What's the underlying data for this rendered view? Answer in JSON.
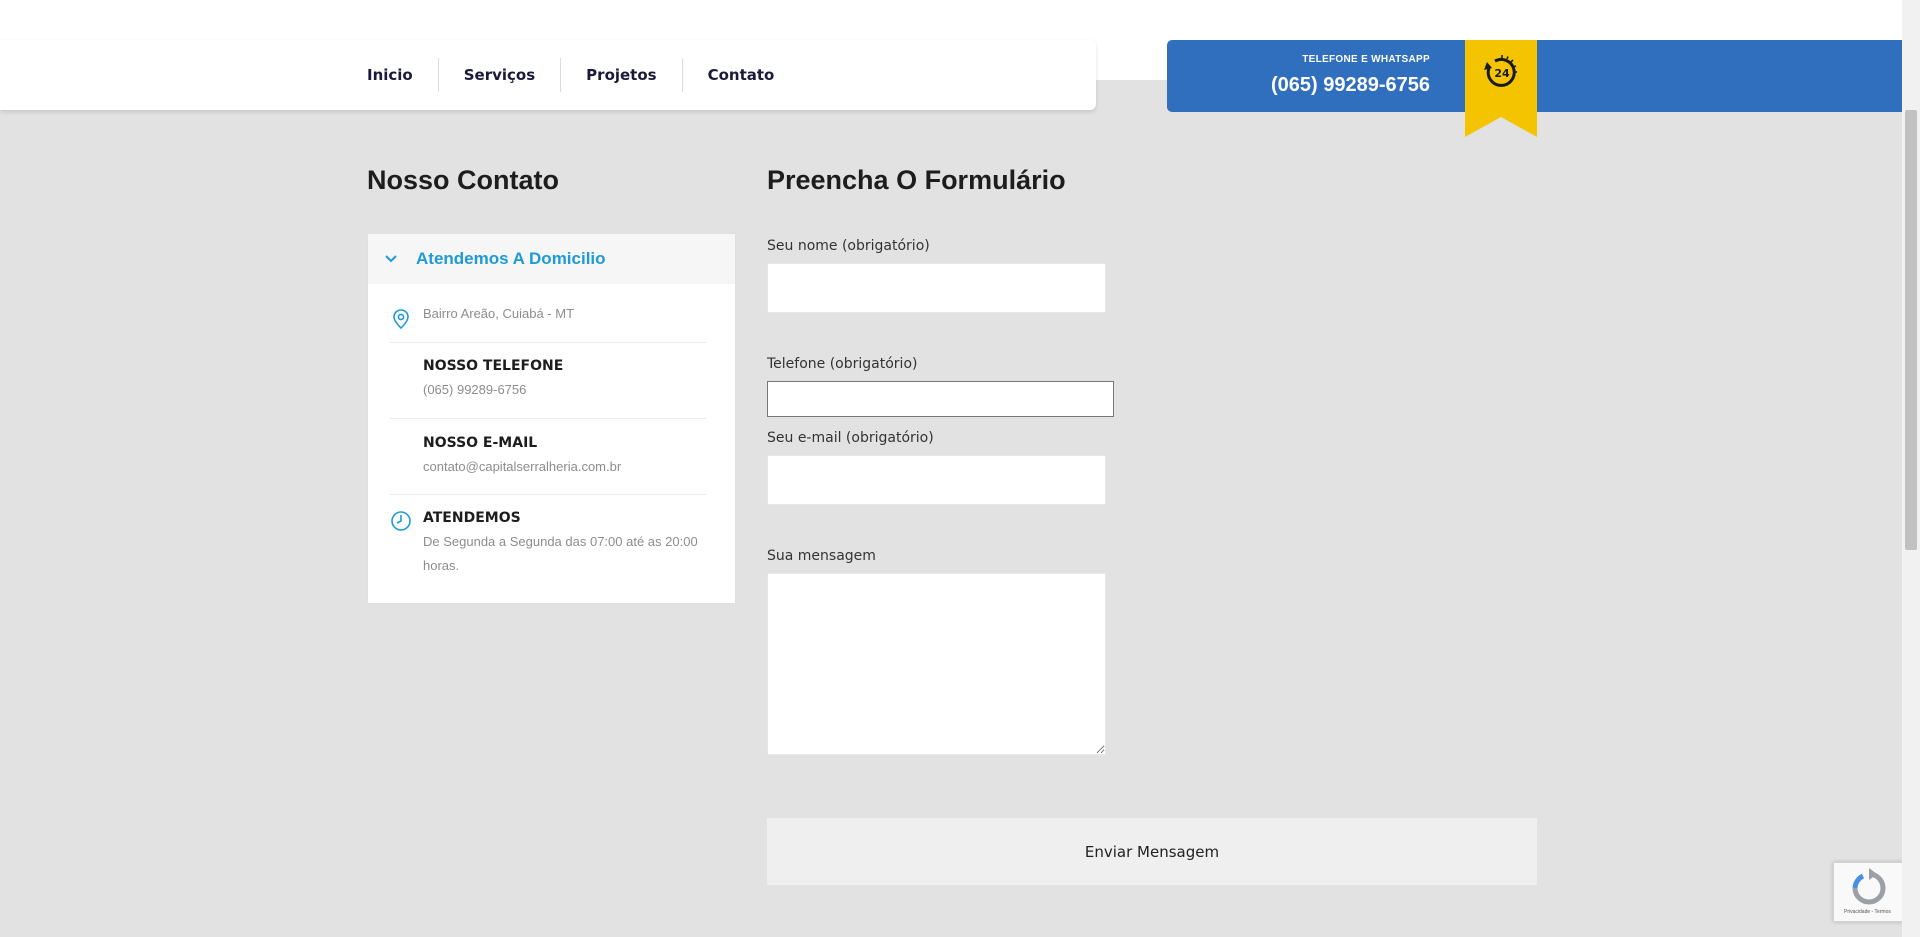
{
  "nav": {
    "items": [
      {
        "label": "Inicio"
      },
      {
        "label": "Serviços"
      },
      {
        "label": "Projetos"
      },
      {
        "label": "Contato"
      }
    ]
  },
  "phone_box": {
    "label": "TELEFONE E WHATSAPP",
    "number": "(065) 99289-6756",
    "badge_text": "24",
    "color": "#2f6fbd",
    "badge_color": "#f5c400"
  },
  "contact": {
    "heading": "Nosso Contato",
    "card_title": "Atendemos A Domicilio",
    "accent_color": "#1e9bd7",
    "address": "Bairro Areão, Cuiabá - MT",
    "phone_title": "NOSSO TELEFONE",
    "phone": "(065) 99289-6756",
    "email_title": "NOSSO E-MAIL",
    "email": "contato@capitalserralheria.com.br",
    "hours_title": "ATENDEMOS",
    "hours": "De Segunda a Segunda das 07:00 até as 20:00 horas.",
    "icons": {
      "address": "map-pin-icon",
      "hours": "clock-icon",
      "card": "chevron-down-icon"
    }
  },
  "form": {
    "heading": "Preencha O Formulário",
    "name_label": "Seu nome (obrigatório)",
    "phone_label": "Telefone (obrigatório)",
    "email_label": "Seu e-mail (obrigatório)",
    "message_label": "Sua mensagem",
    "name_value": "",
    "phone_value": "",
    "email_value": "",
    "message_value": "",
    "submit_label": "Enviar Mensagem"
  },
  "recaptcha": {
    "text": "Privacidade - Termos"
  }
}
